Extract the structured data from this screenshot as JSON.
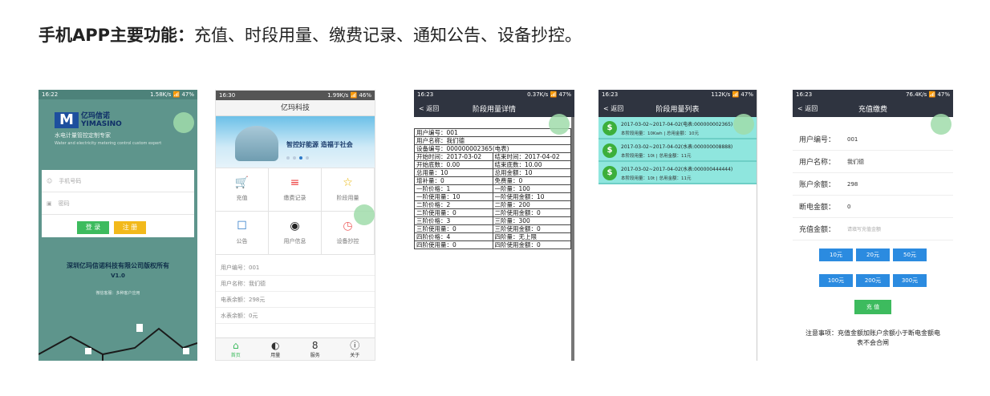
{
  "headline": {
    "bold": "手机APP主要功能",
    "colon": "：",
    "rest": "充值、时段用量、缴费记录、通知公告、设备抄控。"
  },
  "login": {
    "status": "16:22",
    "status_right": "1.58K/s 📶 47%",
    "logo_cn": "亿玛信诺",
    "logo_en": "YIMASINO",
    "slogan": "水电计量管控定制专家",
    "slogan_en": "Water and electricity metering control custom expert",
    "phone_placeholder": "手机号码",
    "password_placeholder": "密码",
    "login_label": "登 录",
    "register_label": "注 册",
    "company": "深圳亿玛信诺科技有限公司版权所有",
    "version": "V1.0",
    "tiny": "微信客服：多种客户应用"
  },
  "home": {
    "status": "16:30",
    "status_right": "1.99K/s 📶 46%",
    "title": "亿玛科技",
    "banner_text": "智控好能源 造福于社会",
    "grid": [
      {
        "icon": "cart-icon",
        "glyph": "🛒",
        "label": "充值"
      },
      {
        "icon": "record-icon",
        "glyph": "≡",
        "label": "缴费记录"
      },
      {
        "icon": "star-icon",
        "glyph": "☆",
        "label": "阶段用量"
      },
      {
        "icon": "message-icon",
        "glyph": "☐",
        "label": "公告"
      },
      {
        "icon": "user-icon",
        "glyph": "◉",
        "label": "用户信息"
      },
      {
        "icon": "clock-icon",
        "glyph": "◷",
        "label": "设备抄控"
      }
    ],
    "info": [
      "用户编号：001",
      "用户名称：我们德",
      "电表余额：298元",
      "水表余额：0元"
    ],
    "tabs": [
      {
        "glyph": "⌂",
        "label": "首页"
      },
      {
        "glyph": "◐",
        "label": "用量"
      },
      {
        "glyph": "8",
        "label": "服务"
      },
      {
        "glyph": "ⓘ",
        "label": "关于"
      }
    ]
  },
  "detail": {
    "status": "16:23",
    "status_right": "0.37K/s 📶 47%",
    "back": "< 返回",
    "title": "阶段用量详情",
    "rows_full": [
      "用户编号：001",
      "用户名称：我们德",
      "设备编号：000000002365(电表)"
    ],
    "rows_pair": [
      [
        "开始时间：2017-03-02",
        "结束时间：2017-04-02"
      ],
      [
        "开始底数：0.00",
        "结束底数：10.00"
      ],
      [
        "总用量：10",
        "总用金额：10"
      ],
      [
        "增补量：0",
        "免费量：0"
      ],
      [
        "一阶价格：1",
        "一阶量：100"
      ],
      [
        "一阶使用量：10",
        "一阶使用金额：10"
      ],
      [
        "二阶价格：2",
        "二阶量：200"
      ],
      [
        "二阶使用量：0",
        "二阶使用金额：0"
      ],
      [
        "三阶价格：3",
        "三阶量：300"
      ],
      [
        "三阶使用量：0",
        "三阶使用金额：0"
      ],
      [
        "四阶价格：4",
        "四阶量：无上限"
      ],
      [
        "四阶使用量：0",
        "四阶使用金额：0"
      ]
    ]
  },
  "list": {
    "status": "16:23",
    "status_right": "112K/s 📶 47%",
    "back": "< 返回",
    "title": "阶段用量列表",
    "items": [
      {
        "l1": "2017-03-02~2017-04-02(电表:000000002365)",
        "l2": "本阶段用量：10Kwh | 总用金额：10元"
      },
      {
        "l1": "2017-03-02~2017-04-02(水表:000000008888)",
        "l2": "本阶段用量：10t | 总用金额：11元"
      },
      {
        "l1": "2017-03-02~2017-04-02(水表:000000444444)",
        "l2": "本阶段用量：10t | 总用金额：11元"
      }
    ]
  },
  "recharge": {
    "status": "16:23",
    "status_right": "76.4K/s 📶 47%",
    "back": "< 返回",
    "title": "充值缴费",
    "fields": [
      {
        "label": "用户编号：",
        "value": "001"
      },
      {
        "label": "用户名称：",
        "value": "我们德"
      },
      {
        "label": "账户余额：",
        "value": "298"
      },
      {
        "label": "断电金额：",
        "value": "0"
      }
    ],
    "amount_label": "充值金额：",
    "amount_placeholder": "请填写充值金额",
    "amounts_row1": [
      "10元",
      "20元",
      "50元"
    ],
    "amounts_row2": [
      "100元",
      "200元",
      "300元"
    ],
    "pay_label": "充 值",
    "notice": "注意事项：充值金额加账户余额小于断电金额电表不会合闸"
  }
}
